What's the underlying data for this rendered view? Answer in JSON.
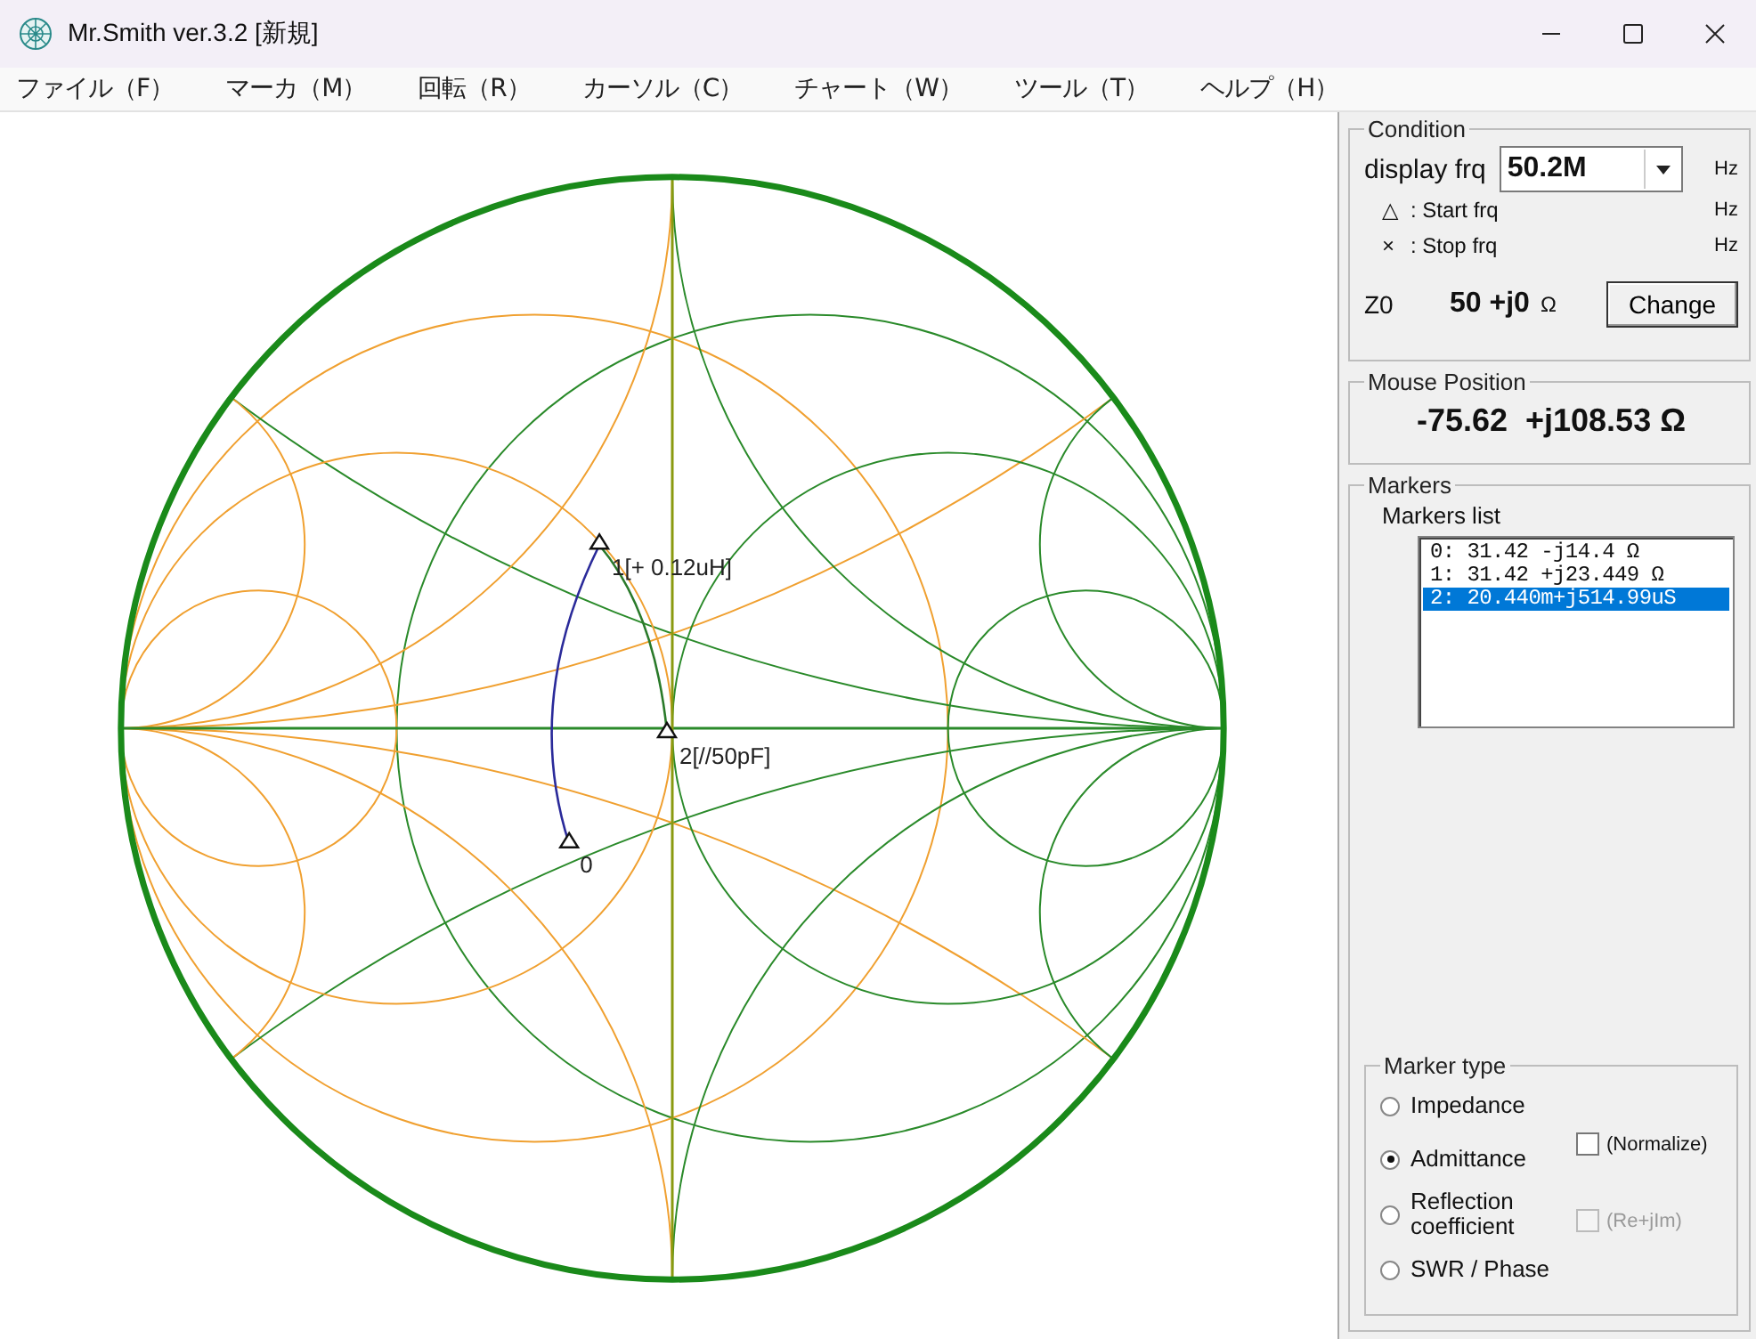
{
  "window": {
    "title": "Mr.Smith ver.3.2 [新規]"
  },
  "menu": [
    {
      "label": "ファイル（F）"
    },
    {
      "label": "マーカ（M）"
    },
    {
      "label": "回転（R）"
    },
    {
      "label": "カーソル（C）"
    },
    {
      "label": "チャート（W）"
    },
    {
      "label": "ツール（T）"
    },
    {
      "label": "ヘルプ（H）"
    }
  ],
  "chart": {
    "markers": [
      {
        "label": "0"
      },
      {
        "label": "1[+ 0.12uH]"
      },
      {
        "label": "2[//50pF]"
      }
    ]
  },
  "condition": {
    "title": "Condition",
    "freq_label": "display frq",
    "freq_value": "50.2M",
    "freq_unit": "Hz",
    "rows": [
      {
        "symbol": "△",
        "label": ": Start frq",
        "unit": "Hz"
      },
      {
        "symbol": "×",
        "label": ": Stop frq",
        "unit": "Hz"
      }
    ],
    "z0_label": "Z0",
    "z0_value": "50 +j0",
    "z0_unit": "Ω",
    "button": "Change"
  },
  "mouse_position": {
    "title": "Mouse Position",
    "value": "-75.62  +j108.53 Ω"
  },
  "markers": {
    "title": "Markers",
    "list_label": "Markers list",
    "items": [
      {
        "text": "0: 31.42 -j14.4 Ω",
        "selected": false
      },
      {
        "text": "1: 31.42 +j23.449 Ω",
        "selected": false
      },
      {
        "text": "2: 20.440m+j514.99uS",
        "selected": true
      }
    ]
  },
  "marker_type": {
    "title": "Marker type",
    "options": [
      {
        "label": "Impedance",
        "selected": false
      },
      {
        "label": "Admittance",
        "selected": true
      },
      {
        "label": "Reflection coefficient",
        "selected": false
      },
      {
        "label": "SWR / Phase",
        "selected": false
      }
    ],
    "checks": [
      {
        "label": "(Normalize)",
        "checked": false,
        "disabled": false
      },
      {
        "label": "(Re+jIm)",
        "checked": false,
        "disabled": true
      }
    ]
  }
}
